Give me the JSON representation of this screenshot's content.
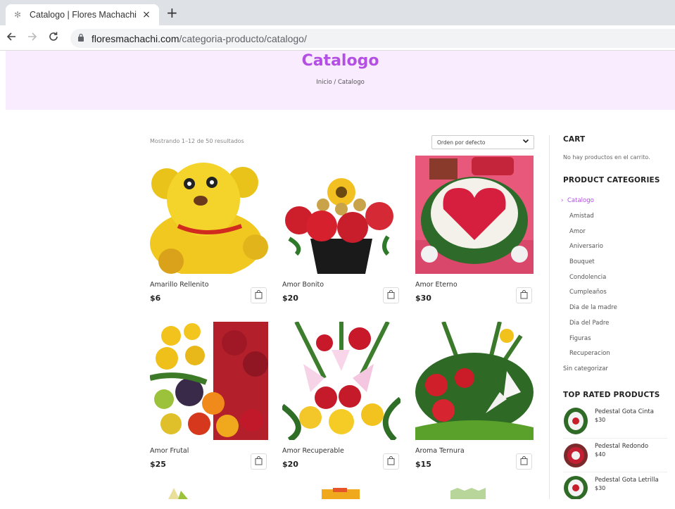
{
  "browser": {
    "tab_title": "Catalogo | Flores Machachi",
    "close_glyph": "×",
    "new_tab_glyph": "+",
    "url_host": "floresmachachi.com",
    "url_path": "/categoria-producto/catalogo/"
  },
  "hero": {
    "title": "Catalogo",
    "breadcrumb": "Inicio / Catalogo"
  },
  "shop": {
    "result_count": "Mostrando 1–12 de 50 resultados",
    "sort_selected": "Orden por defecto"
  },
  "products": [
    {
      "name": "Amarillo Rellenito",
      "price": "$6"
    },
    {
      "name": "Amor Bonito",
      "price": "$20"
    },
    {
      "name": "Amor Eterno",
      "price": "$30"
    },
    {
      "name": "Amor Frutal",
      "price": "$25"
    },
    {
      "name": "Amor Recuperable",
      "price": "$20"
    },
    {
      "name": "Aroma Ternura",
      "price": "$15"
    }
  ],
  "sidebar": {
    "cart_heading": "CART",
    "cart_empty": "No hay productos en el carrito.",
    "categories_heading": "PRODUCT CATEGORIES",
    "categories": [
      {
        "label": "Catalogo",
        "active": true
      },
      {
        "label": "Amistad"
      },
      {
        "label": "Amor"
      },
      {
        "label": "Aniversario"
      },
      {
        "label": "Bouquet"
      },
      {
        "label": "Condolencia"
      },
      {
        "label": "Cumpleaños"
      },
      {
        "label": "Dia de la madre"
      },
      {
        "label": "Dia del Padre"
      },
      {
        "label": "Figuras"
      },
      {
        "label": "Recuperacion"
      },
      {
        "label": "Sin categorizar"
      }
    ],
    "top_heading": "TOP RATED PRODUCTS",
    "top_products": [
      {
        "name": "Pedestal Gota Cinta",
        "price": "$30"
      },
      {
        "name": "Pedestal Redondo",
        "price": "$40"
      },
      {
        "name": "Pedestal Gota Letrilla",
        "price": "$30"
      }
    ]
  },
  "colors": {
    "accent": "#b34fe2",
    "hero_bg": "#f9ecfe"
  }
}
